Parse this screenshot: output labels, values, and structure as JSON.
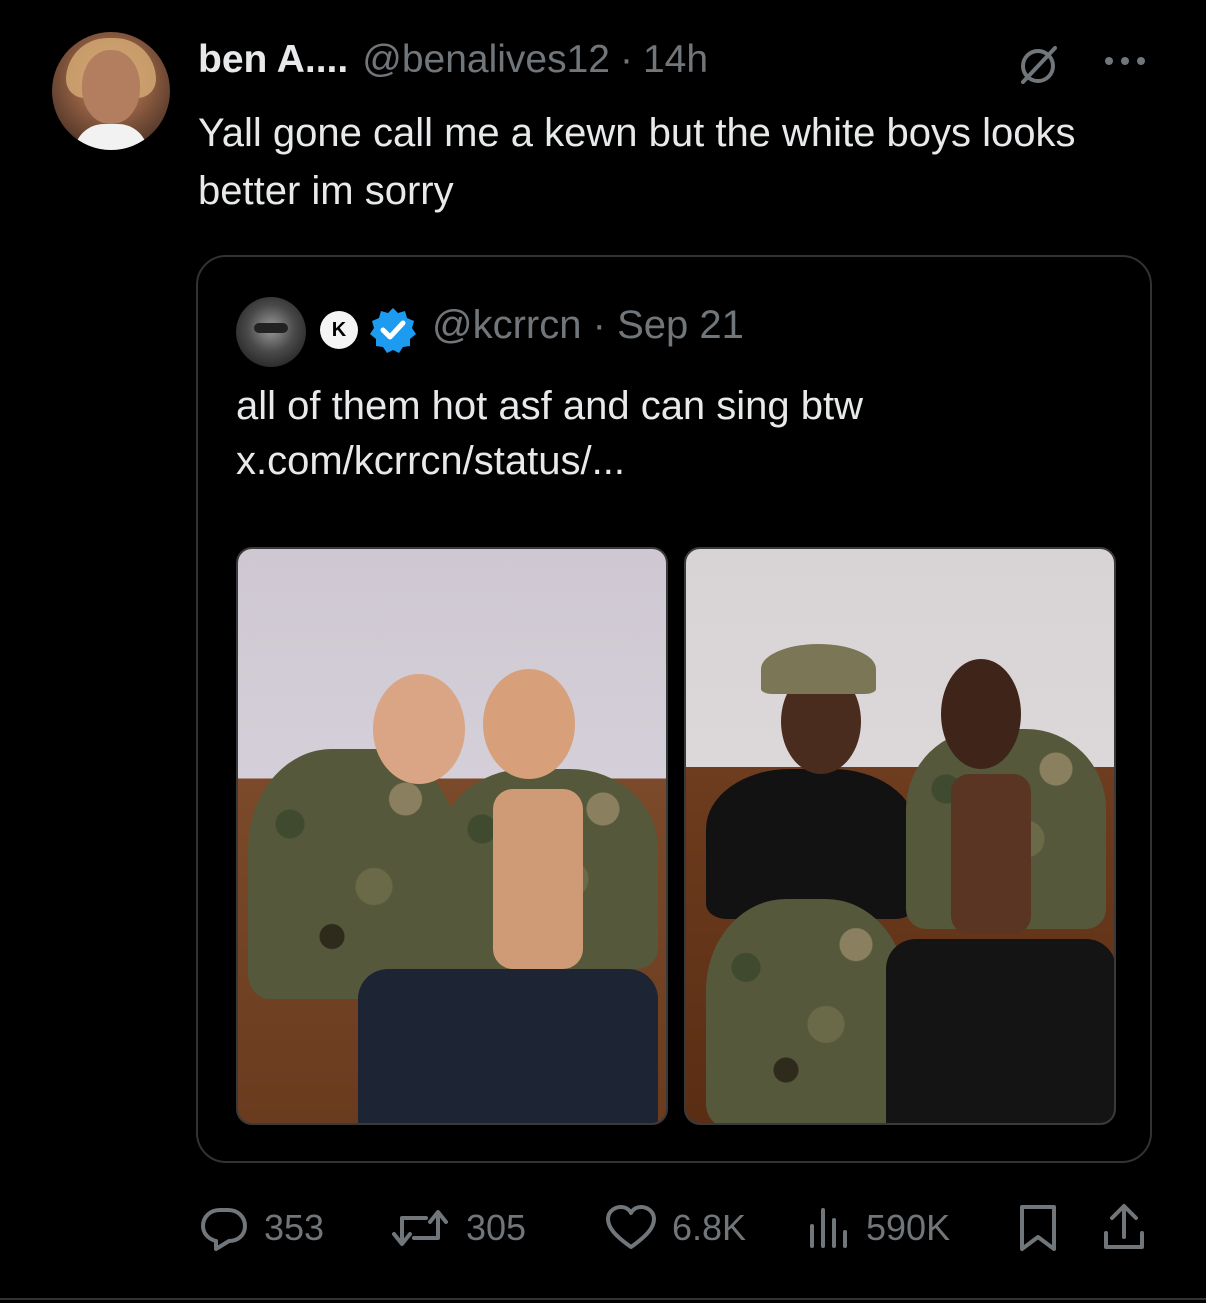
{
  "post": {
    "author_name": "ben A....",
    "author_handle": "@benalives12",
    "separator": "·",
    "time": "14h",
    "text": "Yall gone call me a kewn but the white boys looks better im sorry",
    "icons": {
      "grok": "grok-icon",
      "more": "more-icon"
    }
  },
  "quote": {
    "badge_letter": "K",
    "handle": "@kcrrcn",
    "separator": "·",
    "date": "Sep 21",
    "text_line1": "all of them hot asf and can sing btw",
    "text_line2": "x.com/kcrrcn/status/...",
    "verified_color": "#1d9bf0"
  },
  "actions": {
    "replies": "353",
    "reposts": "305",
    "likes": "6.8K",
    "views": "590K"
  },
  "colors": {
    "background": "#000000",
    "text": "#e7e9ea",
    "secondary": "#71767b",
    "border": "#2f3336"
  }
}
